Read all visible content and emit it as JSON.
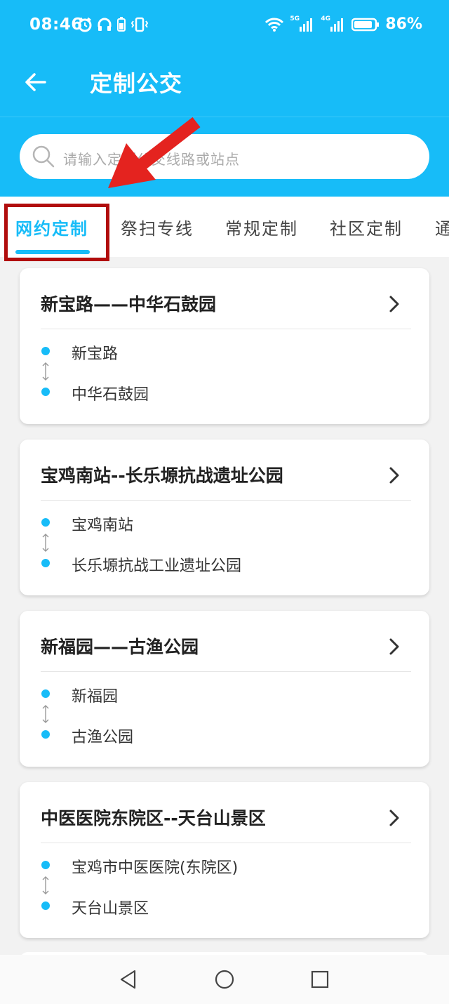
{
  "status_bar": {
    "time": "08:46",
    "battery_text": "86%",
    "network_5g": "5G",
    "network_4g": "4G"
  },
  "app_bar": {
    "title": "定制公交",
    "back_icon": "arrow-left-icon"
  },
  "search": {
    "placeholder": "请输入定制公交线路或站点",
    "icon": "search-icon"
  },
  "tabs": [
    {
      "label": "网约定制",
      "active": true
    },
    {
      "label": "祭扫专线",
      "active": false
    },
    {
      "label": "常规定制",
      "active": false
    },
    {
      "label": "社区定制",
      "active": false
    },
    {
      "label": "通",
      "active": false
    }
  ],
  "routes": [
    {
      "title": "新宝路——中华石鼓园",
      "from": "新宝路",
      "to": "中华石鼓园"
    },
    {
      "title": "宝鸡南站--长乐塬抗战遗址公园",
      "from": "宝鸡南站",
      "to": "长乐塬抗战工业遗址公园"
    },
    {
      "title": "新福园——古渔公园",
      "from": "新福园",
      "to": "古渔公园"
    },
    {
      "title": "中医医院东院区--天台山景区",
      "from": "宝鸡市中医医院(东院区)",
      "to": "天台山景区"
    }
  ],
  "colors": {
    "primary": "#17bcf8",
    "annotation_red": "#b10d0d",
    "arrow_red": "#e4231f"
  },
  "nav": {
    "back": "triangle-back-icon",
    "home": "circle-home-icon",
    "recents": "square-recents-icon"
  }
}
